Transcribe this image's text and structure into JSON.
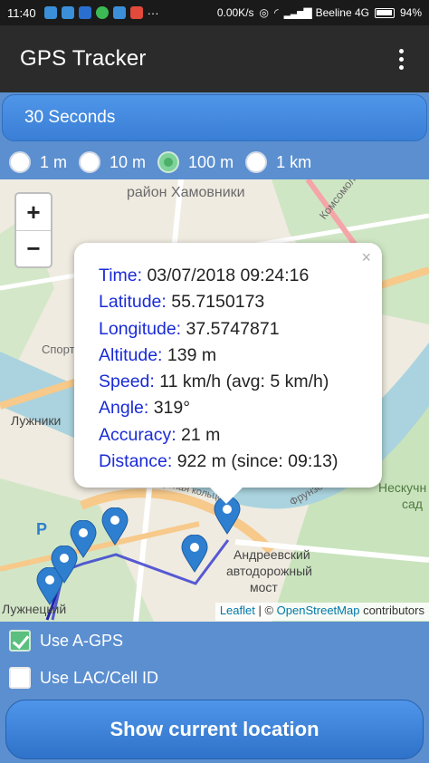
{
  "status_bar": {
    "time": "11:40",
    "network_speed": "0.00K/s",
    "carrier": "Beeline 4G",
    "battery": "94%"
  },
  "app_bar": {
    "title": "GPS Tracker",
    "menu_icon": "overflow-menu-icon"
  },
  "interval": {
    "selected": "30 Seconds"
  },
  "distance_filter": {
    "options": [
      "1 m",
      "10 m",
      "100 m",
      "1 km"
    ],
    "selected": "100 m"
  },
  "map": {
    "zoom_in": "+",
    "zoom_out": "−",
    "labels": {
      "district": "район Хамовники",
      "komsomolsky": "Комсомольский",
      "luzhniki": "Лужники",
      "luzhnetsky": "Лужнецкий",
      "frunzenskaya": "Фрунзе",
      "neskuchny": "Нескучн",
      "sad": "сад",
      "bridge_1": "Андреевский",
      "bridge_2": "автодорожный",
      "bridge_3": "мост",
      "sport": "Спорт",
      "sport_street": "портная кольцо",
      "parking": "P"
    },
    "attribution": {
      "leaflet": "Leaflet",
      "separator": " | © ",
      "osm": "OpenStreetMap",
      "suffix": " contributors"
    }
  },
  "popup": {
    "close": "×",
    "rows": [
      {
        "key": "Time:",
        "value": " 03/07/2018 09:24:16"
      },
      {
        "key": "Latitude:",
        "value": " 55.7150173"
      },
      {
        "key": "Longitude:",
        "value": " 37.5747871"
      },
      {
        "key": "Altitude:",
        "value": " 139 m"
      },
      {
        "key": "Speed:",
        "value": " 11 km/h (avg: 5 km/h)"
      },
      {
        "key": "Angle:",
        "value": " 319°"
      },
      {
        "key": "Accuracy:",
        "value": " 21 m"
      },
      {
        "key": "Distance:",
        "value": " 922 m (since: 09:13)"
      }
    ]
  },
  "options": {
    "agps_label": "Use A-GPS",
    "agps_checked": true,
    "lac_label": "Use LAC/Cell ID",
    "lac_checked": false
  },
  "action_button": {
    "label": "Show current location"
  },
  "colors": {
    "accent_blue": "#3a7fd6",
    "track_line": "#3b3fd0",
    "marker_blue": "#2f7fd0"
  }
}
